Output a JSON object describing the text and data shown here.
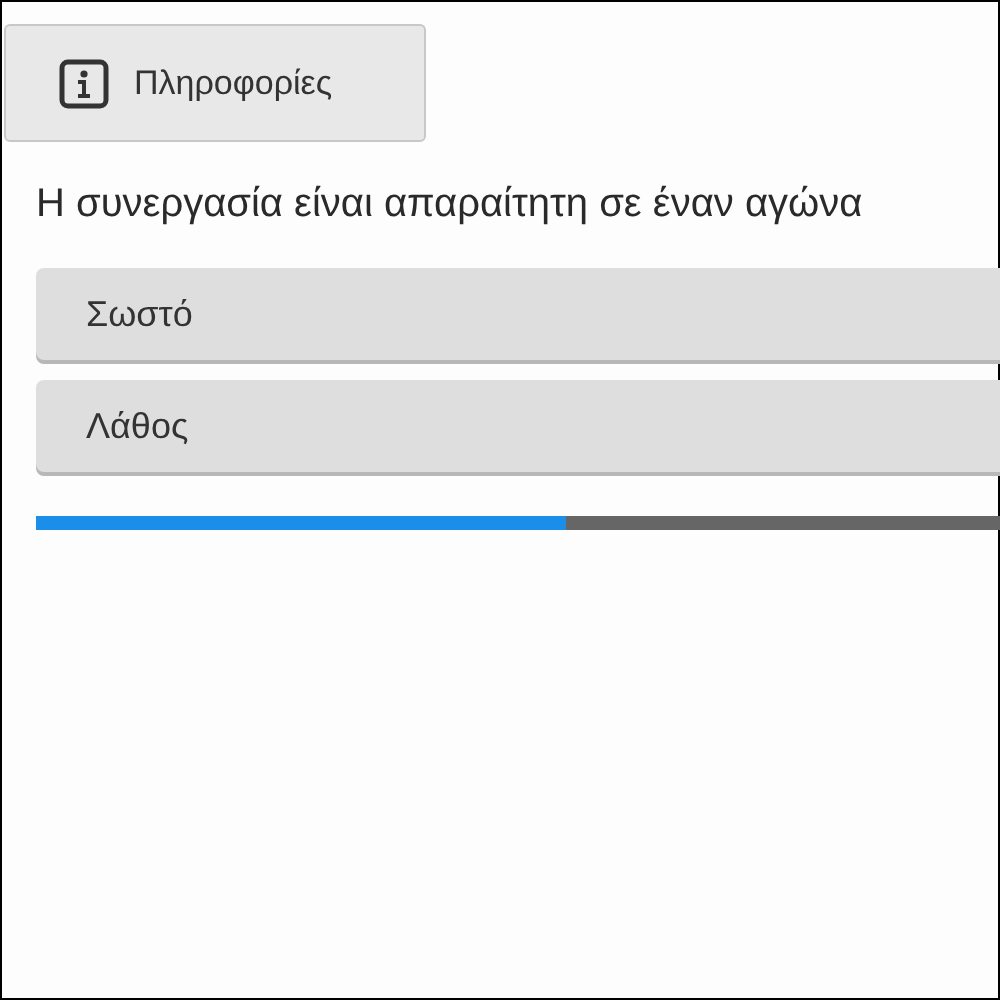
{
  "info_button": {
    "label": "Πληροφορίες"
  },
  "question": "Η συνεργασία είναι απαραίτητη σε έναν αγώνα",
  "answers": [
    {
      "label": "Σωστό"
    },
    {
      "label": "Λάθος"
    }
  ],
  "progress": {
    "level": 0.55
  }
}
